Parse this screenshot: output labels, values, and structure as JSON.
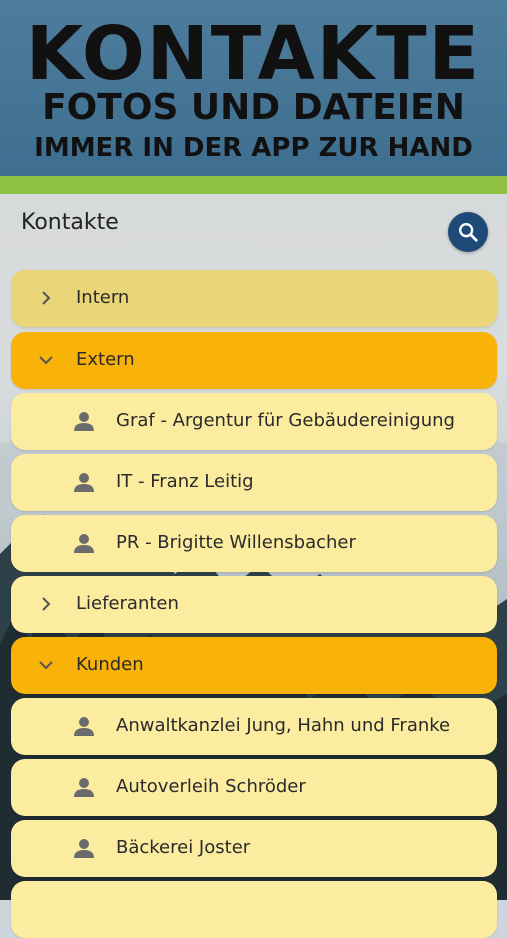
{
  "banner": {
    "line1": "KONTAKTE",
    "line2": "FOTOS UND DATEIEN",
    "line3": "IMMER IN DER APP ZUR HAND"
  },
  "colors": {
    "banner_bg": "#4d7c9c",
    "accent_strip": "#8dc043",
    "group_row": "#fbeca0",
    "expanded_row": "#f8b208",
    "search_button": "#1d4a78"
  },
  "header": {
    "title": "Kontakte"
  },
  "icons": {
    "search": "search-icon",
    "chevron_right": "chevron-right-icon",
    "chevron_down": "chevron-down-icon",
    "person": "person-icon"
  },
  "list": [
    {
      "type": "group",
      "label": "Intern",
      "expanded": false
    },
    {
      "type": "group",
      "label": "Extern",
      "expanded": true
    },
    {
      "type": "contact",
      "label": "Graf - Argentur für Gebäudereinigung"
    },
    {
      "type": "contact",
      "label": "IT - Franz Leitig"
    },
    {
      "type": "contact",
      "label": "PR - Brigitte Willensbacher"
    },
    {
      "type": "group",
      "label": "Lieferanten",
      "expanded": false
    },
    {
      "type": "group",
      "label": "Kunden",
      "expanded": true
    },
    {
      "type": "contact",
      "label": "Anwaltkanzlei Jung, Hahn und Franke"
    },
    {
      "type": "contact",
      "label": "Autoverleih Schröder"
    },
    {
      "type": "contact",
      "label": "Bäckerei Joster"
    },
    {
      "type": "contact",
      "label": ""
    }
  ]
}
